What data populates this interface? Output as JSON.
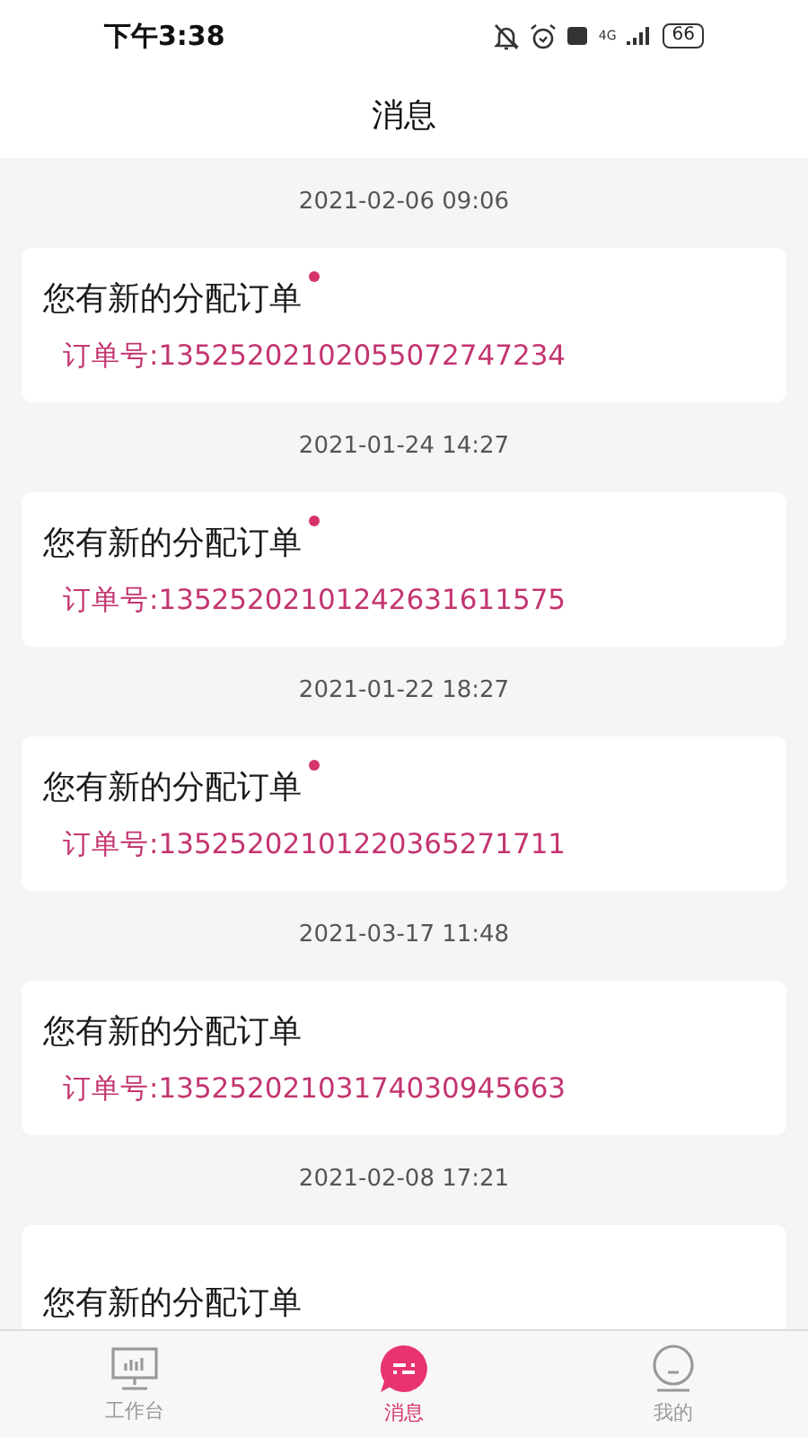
{
  "status_bar": {
    "time": "下午3:38",
    "network": "4G",
    "battery": "66"
  },
  "header": {
    "title": "消息"
  },
  "messages": [
    {
      "time": "2021-02-06 09:06",
      "title": "您有新的分配订单",
      "unread": true,
      "order": "订单号:13525202102055072747234"
    },
    {
      "time": "2021-01-24 14:27",
      "title": "您有新的分配订单",
      "unread": true,
      "order": "订单号:13525202101242631611575"
    },
    {
      "time": "2021-01-22 18:27",
      "title": "您有新的分配订单",
      "unread": true,
      "order": "订单号:13525202101220365271711"
    },
    {
      "time": "2021-03-17 11:48",
      "title": "您有新的分配订单",
      "unread": false,
      "order": "订单号:13525202103174030945663"
    },
    {
      "time": "2021-02-08 17:21",
      "title": "您有新的分配订单",
      "unread": false
    }
  ],
  "tab_bar": [
    {
      "label": "工作台",
      "kind": "workbench",
      "selected": false
    },
    {
      "label": "消息",
      "kind": "messages",
      "selected": true
    },
    {
      "label": "我的",
      "kind": "profile",
      "selected": false
    }
  ]
}
